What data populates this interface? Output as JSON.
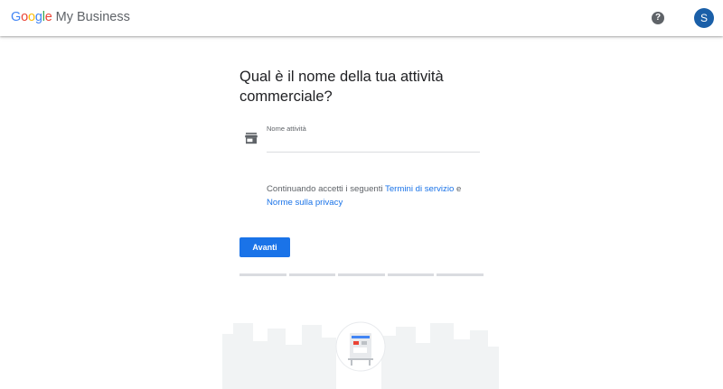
{
  "header": {
    "logo_letters": [
      {
        "char": "G",
        "color": "#4285F4"
      },
      {
        "char": "o",
        "color": "#EA4335"
      },
      {
        "char": "o",
        "color": "#FBBC05"
      },
      {
        "char": "g",
        "color": "#4285F4"
      },
      {
        "char": "l",
        "color": "#34A853"
      },
      {
        "char": "e",
        "color": "#EA4335"
      }
    ],
    "product_name": "My Business",
    "help_icon": "help-circle-icon",
    "help_glyph": "?",
    "avatar_initial": "S",
    "avatar_color": "#1a5fa8"
  },
  "form": {
    "title": "Qual è il nome della tua attività commerciale?",
    "field_icon": "storefront-icon",
    "field_label": "Nome attività",
    "field_value": "",
    "terms_prefix": "Continuando accetti i seguenti",
    "terms_link": "Termini di servizio",
    "terms_conjunction": "e",
    "privacy_link": "Norme sulla privacy",
    "next_button": "Avanti",
    "accent_color": "#1a73e8"
  },
  "progress": {
    "steps_total": 5
  },
  "illustration": {
    "icon": "city-storefront-illustration"
  }
}
